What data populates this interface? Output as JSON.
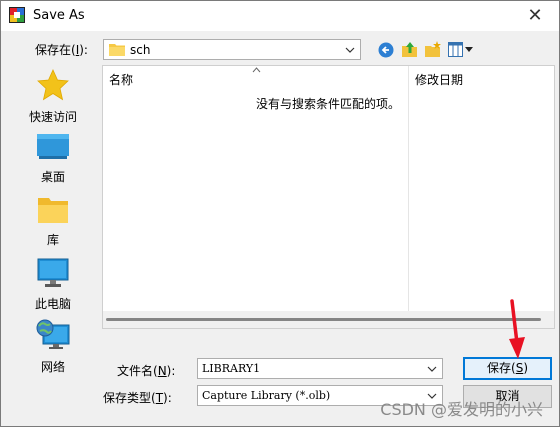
{
  "window": {
    "title": "Save As",
    "close_glyph": "✕"
  },
  "save_in": {
    "label": "保存在(",
    "accel": "I",
    "label_end": "):",
    "value": "sch"
  },
  "places": [
    {
      "label": "快速访问",
      "icon": "star-icon"
    },
    {
      "label": "桌面",
      "icon": "desktop-icon"
    },
    {
      "label": "库",
      "icon": "library-folder-icon"
    },
    {
      "label": "此电脑",
      "icon": "computer-icon"
    },
    {
      "label": "网络",
      "icon": "network-icon"
    }
  ],
  "list": {
    "col_name": "名称",
    "col_date": "修改日期",
    "empty_message": "没有与搜索条件匹配的项。"
  },
  "filename": {
    "label": "文件名(",
    "accel": "N",
    "label_end": "):",
    "value": "LIBRARY1"
  },
  "filetype": {
    "label": "保存类型(",
    "accel": "T",
    "label_end": "):",
    "value": "Capture Library (*.olb)"
  },
  "buttons": {
    "save": "保存(",
    "save_accel": "S",
    "save_end": ")",
    "cancel": "取消"
  },
  "watermark": "CSDN @爱发明的小兴",
  "colors": {
    "accent": "#0078d7",
    "arrow": "#e81123"
  }
}
